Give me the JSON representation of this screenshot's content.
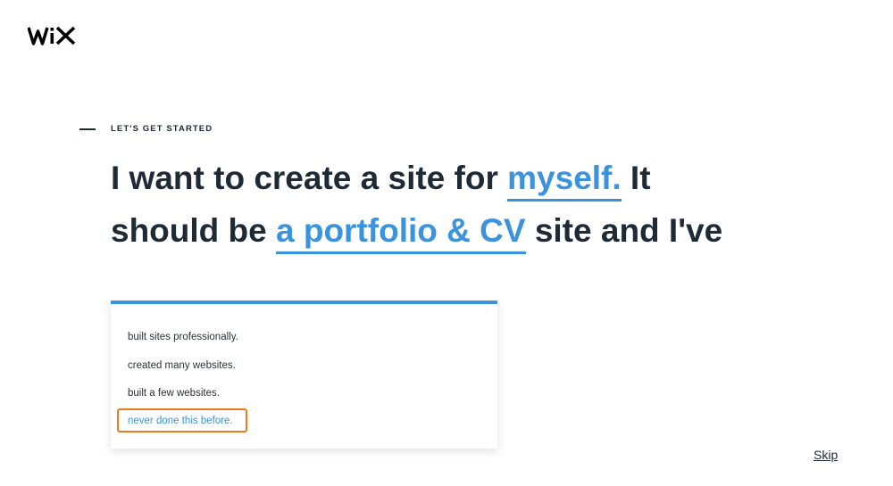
{
  "logo": {
    "text": "WiX"
  },
  "eyebrow": {
    "label": "LET'S GET STARTED"
  },
  "headline": {
    "part1": "I want to create a site for ",
    "choice1": "myself.",
    "part2": " It",
    "part3": "should be ",
    "choice2": "a portfolio & CV",
    "part4": " site and I've"
  },
  "options": [
    "built sites professionally.",
    "created many websites.",
    "built a few websites.",
    "never done this before."
  ],
  "skip": "Skip",
  "colors": {
    "accent": "#3a93df",
    "text": "#1e2a36",
    "highlight": "#ef7a1e"
  }
}
